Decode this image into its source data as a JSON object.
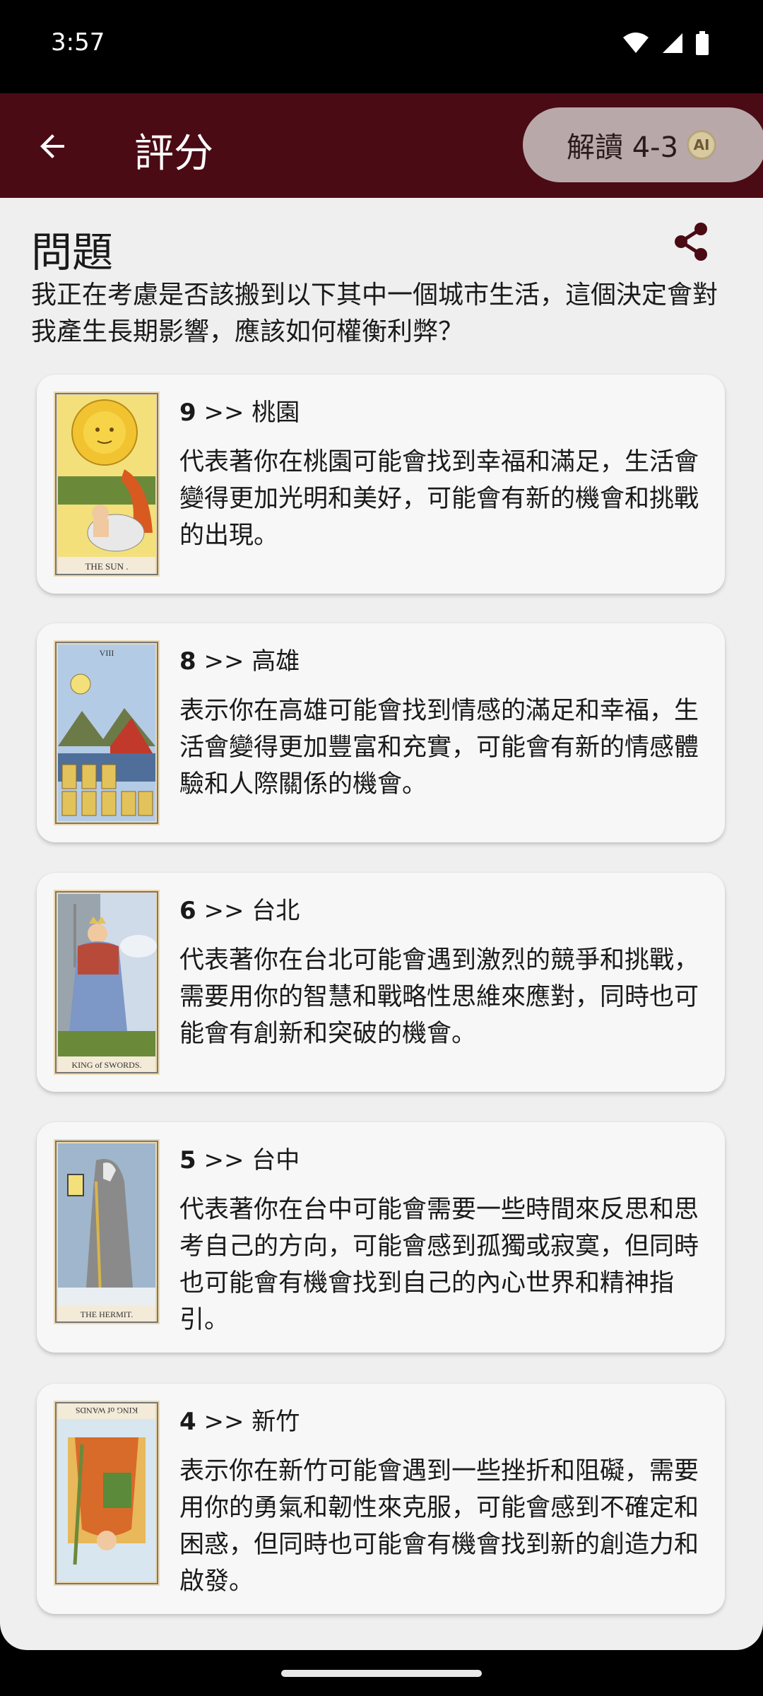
{
  "status_bar": {
    "time": "3:57"
  },
  "app_bar": {
    "title": "評分",
    "ai_button_label": "解讀 4-3",
    "ai_badge": "AI"
  },
  "question": {
    "heading": "問題",
    "text": "我正在考慮是否該搬到以下其中一個城市生活，這個決定會對我產生長期影響，應該如何權衡利弊？"
  },
  "cards": [
    {
      "score": "9",
      "separator": ">>",
      "city": "桃園",
      "card_name": "THE SUN .",
      "body": "代表著你在桃園可能會找到幸福和滿足，生活會變得更加光明和美好，可能會有新的機會和挑戰的出現。"
    },
    {
      "score": "8",
      "separator": ">>",
      "city": "高雄",
      "card_name": "VIII",
      "body": "表示你在高雄可能會找到情感的滿足和幸福，生活會變得更加豐富和充實，可能會有新的情感體驗和人際關係的機會。"
    },
    {
      "score": "6",
      "separator": ">>",
      "city": "台北",
      "card_name": "KING of SWORDS.",
      "body": "代表著你在台北可能會遇到激烈的競爭和挑戰，需要用你的智慧和戰略性思維來應對，同時也可能會有創新和突破的機會。"
    },
    {
      "score": "5",
      "separator": ">>",
      "city": "台中",
      "card_name": "THE HERMIT.",
      "body": "代表著你在台中可能會需要一些時間來反思和思考自己的方向，可能會感到孤獨或寂寞，但同時也可能會有機會找到自己的內心世界和精神指引。"
    },
    {
      "score": "4",
      "separator": ">>",
      "city": "新竹",
      "card_name": "KING of WANDS",
      "body": "表示你在新竹可能會遇到一些挫折和阻礙，需要用你的勇氣和韌性來克服，可能會感到不確定和困惑，但同時也可能會有機會找到新的創造力和啟發。"
    }
  ],
  "colors": {
    "app_bar": "#4a0b14",
    "ai_button": "#b9a8aa",
    "background": "#efefef",
    "card": "#f7f7f7"
  }
}
